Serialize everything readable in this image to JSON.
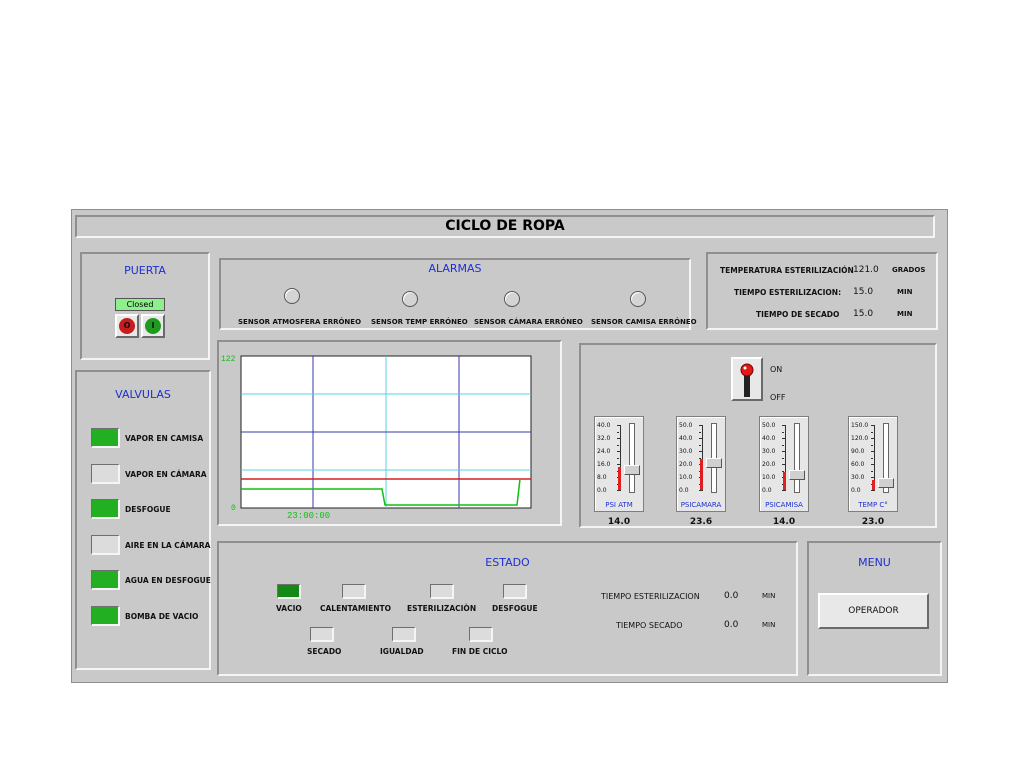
{
  "title": "CICLO DE ROPA",
  "puerta": {
    "title": "PUERTA",
    "status": "Closed",
    "btn_off": "O",
    "btn_on": "I"
  },
  "valvulas": {
    "title": "VALVULAS",
    "items": [
      {
        "label": "VAPOR EN CAMISA",
        "state": "on"
      },
      {
        "label": "VAPOR EN CÁMARA",
        "state": "off"
      },
      {
        "label": "DESFOGUE",
        "state": "on"
      },
      {
        "label": "AIRE EN LA CÁMARA",
        "state": "off"
      },
      {
        "label": "AGUA EN DESFOGUE",
        "state": "on"
      },
      {
        "label": "BOMBA DE VACIO",
        "state": "on"
      }
    ]
  },
  "alarmas": {
    "title": "ALARMAS",
    "items": [
      {
        "label": "SENSOR ATMOSFERA ERRÓNEO"
      },
      {
        "label": "SENSOR TEMP ERRÓNEO"
      },
      {
        "label": "SENSOR CÁMARA  ERRÓNEO"
      },
      {
        "label": "SENSOR CAMISA ERRÓNEO"
      }
    ]
  },
  "parametros": {
    "rows": [
      {
        "label": "TEMPERATURA ESTERILIZACIÓN",
        "value": "121.0",
        "unit": "GRADOS"
      },
      {
        "label": "TIEMPO ESTERILIZACION:",
        "value": "15.0",
        "unit": "MIN"
      },
      {
        "label": "TIEMPO DE SECADO",
        "value": "15.0",
        "unit": "MIN"
      }
    ]
  },
  "chart": {
    "y_max_label": "122",
    "y_min_label": "0",
    "time_label": "23:00:00"
  },
  "switch": {
    "on_label": "ON",
    "off_label": "OFF"
  },
  "sliders": [
    {
      "name": "PSI ATM",
      "value": "14.0",
      "ticks": [
        "40.0",
        "32.0",
        "24.0",
        "16.0",
        "8.0",
        "0.0"
      ],
      "fraction": 0.35
    },
    {
      "name": "PSICAMARA",
      "value": "23.6",
      "ticks": [
        "50.0",
        "40.0",
        "30.0",
        "20.0",
        "10.0",
        "0.0"
      ],
      "fraction": 0.47
    },
    {
      "name": "PSICAMISA",
      "value": "14.0",
      "ticks": [
        "50.0",
        "40.0",
        "30.0",
        "20.0",
        "10.0",
        "0.0"
      ],
      "fraction": 0.28
    },
    {
      "name": "TEMP C°",
      "value": "23.0",
      "ticks": [
        "150.0",
        "120.0",
        "90.0",
        "60.0",
        "30.0",
        "0.0"
      ],
      "fraction": 0.15
    }
  ],
  "estado": {
    "title": "ESTADO",
    "steps": [
      {
        "label": "VACIO",
        "state": "on"
      },
      {
        "label": "CALENTAMIENTO",
        "state": "off"
      },
      {
        "label": "ESTERILIZACIÒN",
        "state": "off"
      },
      {
        "label": "DESFOGUE",
        "state": "off"
      },
      {
        "label": "SECADO",
        "state": "off"
      },
      {
        "label": "IGUALDAD",
        "state": "off"
      },
      {
        "label": "FIN DE CICLO",
        "state": "off"
      }
    ],
    "timers": [
      {
        "label": "TIEMPO ESTERILIZACION",
        "value": "0.0",
        "unit": "MIN"
      },
      {
        "label": "TIEMPO SECADO",
        "value": "0.0",
        "unit": "MIN"
      }
    ]
  },
  "menu": {
    "title": "MENU",
    "button": "OPERADOR"
  },
  "colors": {
    "led_on": "#22b022",
    "led_off": "#dcdcdc",
    "title_blue": "#1c2fd3",
    "trend_red": "#d42020",
    "trend_green": "#10c010"
  }
}
